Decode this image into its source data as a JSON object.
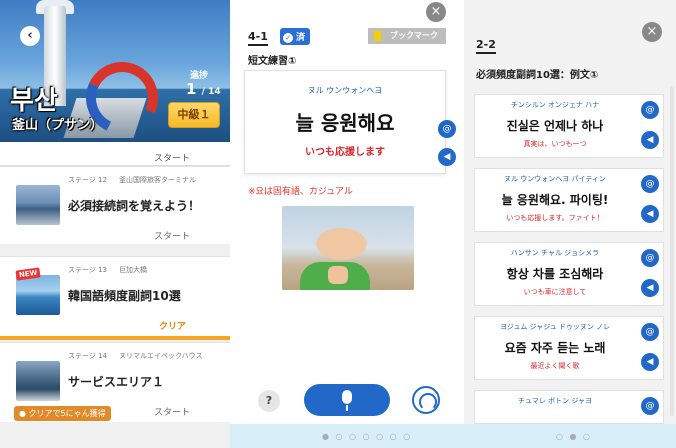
{
  "panel1": {
    "back_icon": "chevron-left-icon",
    "city_korean": "부산",
    "city_japanese": "釜山（プサン）",
    "progress_label": "進捗",
    "progress_current": "1",
    "progress_total": "/ 14",
    "level_badge": "中級１",
    "top_start": "スタート",
    "stages": [
      {
        "stage": "ステージ 12",
        "location": "釜山国際旅客ターミナル",
        "title": "必須接続詞を覚えよう！",
        "action": "スタート",
        "new": ""
      },
      {
        "stage": "ステージ 13",
        "location": "巨加大橋",
        "title": "韓国語頻度副詞10選",
        "action": "クリア",
        "new": "NEW"
      },
      {
        "stage": "ステージ 14",
        "location": "ヌリマルエイペックハウス",
        "title": "サービスエリア１",
        "action": "スタート",
        "new": ""
      }
    ],
    "reward_text": "クリアで5にゃん獲得"
  },
  "panel2": {
    "close_icon": "×",
    "lesson_number": "4-1",
    "done_label": "済",
    "bookmark_label": "ブックマーク",
    "section_title": "短文練習①",
    "phrase_kana": "ヌル ウンウォンヘヨ",
    "phrase_korean": "늘 응원해요",
    "phrase_japanese": "いつも応援します",
    "note": "※요は固有語、カジュアル",
    "help_label": "?"
  },
  "panel3": {
    "close_icon": "×",
    "lesson_number": "2-2",
    "section_title": "必須頻度副詞10選：例文①",
    "examples": [
      {
        "kana": "チンシルン オンジェナ ハナ",
        "korean": "진실은 언제나 하나",
        "japanese": "真実は、いつも一つ"
      },
      {
        "kana": "ヌル ウンウォンヘヨ パイティン",
        "korean": "늘 응원해요. 파이팅!",
        "japanese": "いつも応援します。ファイト！"
      },
      {
        "kana": "ハンサン チャル ジョシメラ",
        "korean": "항상 차를 조심해라",
        "japanese": "いつも車に注意して"
      },
      {
        "kana": "ヨジュム ジャジュ ドゥッヌン ノレ",
        "korean": "요즘 자주 듣는 노래",
        "japanese": "最近よく聞く歌"
      },
      {
        "kana": "チュマレ ボトン ジャヨ",
        "korean": "",
        "japanese": ""
      }
    ]
  },
  "colors": {
    "accent_blue": "#2268c8",
    "red_text": "#d9262b",
    "badge_gold": "#f6b928",
    "clear_orange": "#e08a00"
  }
}
